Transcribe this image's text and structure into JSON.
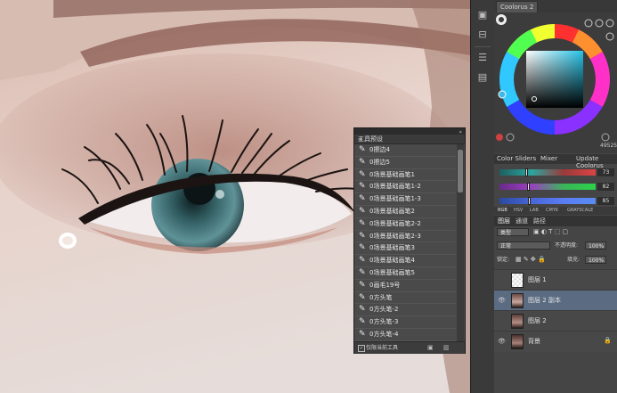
{
  "color_panel": {
    "tab_label": "Coolorus 2",
    "hex_value": "49525",
    "tabs": [
      "Color Sliders",
      "Mixer",
      "Update Coolorus"
    ],
    "sliders": [
      {
        "value": "73",
        "level": 0.28,
        "gradient": "linear-gradient(90deg,#1f5f5f,#2aa6a0,#9a3a3a,#d44)"
      },
      {
        "value": "82",
        "level": 0.3,
        "gradient": "linear-gradient(90deg,#6a2a8a,#9a40c0,#3bb55a,#2ad24a)"
      },
      {
        "value": "85",
        "level": 0.31,
        "gradient": "linear-gradient(90deg,#2a4aa0,#4866d8,#5a7cf2,#5a8cf2)"
      }
    ],
    "modes": [
      "RGB",
      "HSV",
      "LAB",
      "CMYK",
      "GRAYSCALE"
    ]
  },
  "layers_panel": {
    "tabs": [
      "图层",
      "通道",
      "路径"
    ],
    "kind_label": "类型",
    "blend_mode": "正常",
    "opacity_label": "不透明度:",
    "opacity_value": "100%",
    "lock_label": "锁定:",
    "fill_label": "填充:",
    "fill_value": "100%",
    "layers": [
      {
        "name": "图层 1",
        "visible": false,
        "selected": false,
        "locked": false
      },
      {
        "name": "图层 2 副本",
        "visible": true,
        "selected": true,
        "locked": false
      },
      {
        "name": "图层 2",
        "visible": false,
        "selected": false,
        "locked": false
      },
      {
        "name": "背景",
        "visible": true,
        "selected": false,
        "locked": true
      }
    ]
  },
  "brush_panel": {
    "title": "工具预设",
    "items": [
      "0擦边4",
      "0擦边5",
      "0场景基础画笔1",
      "0场景基础画笔1-2",
      "0场景基础画笔1-3",
      "0场景基础画笔2",
      "0场景基础画笔2-2",
      "0场景基础画笔2-3",
      "0场景基础画笔3",
      "0场景基础画笔4",
      "0场景基础画笔5",
      "0画毛19号",
      "0方头笔",
      "0方头笔-2",
      "0方头笔-3",
      "0方头笔-4"
    ],
    "footer_label": "仅限当前工具"
  },
  "icons": {
    "brush": "✎",
    "eye": "👁",
    "lock": "🔒"
  }
}
